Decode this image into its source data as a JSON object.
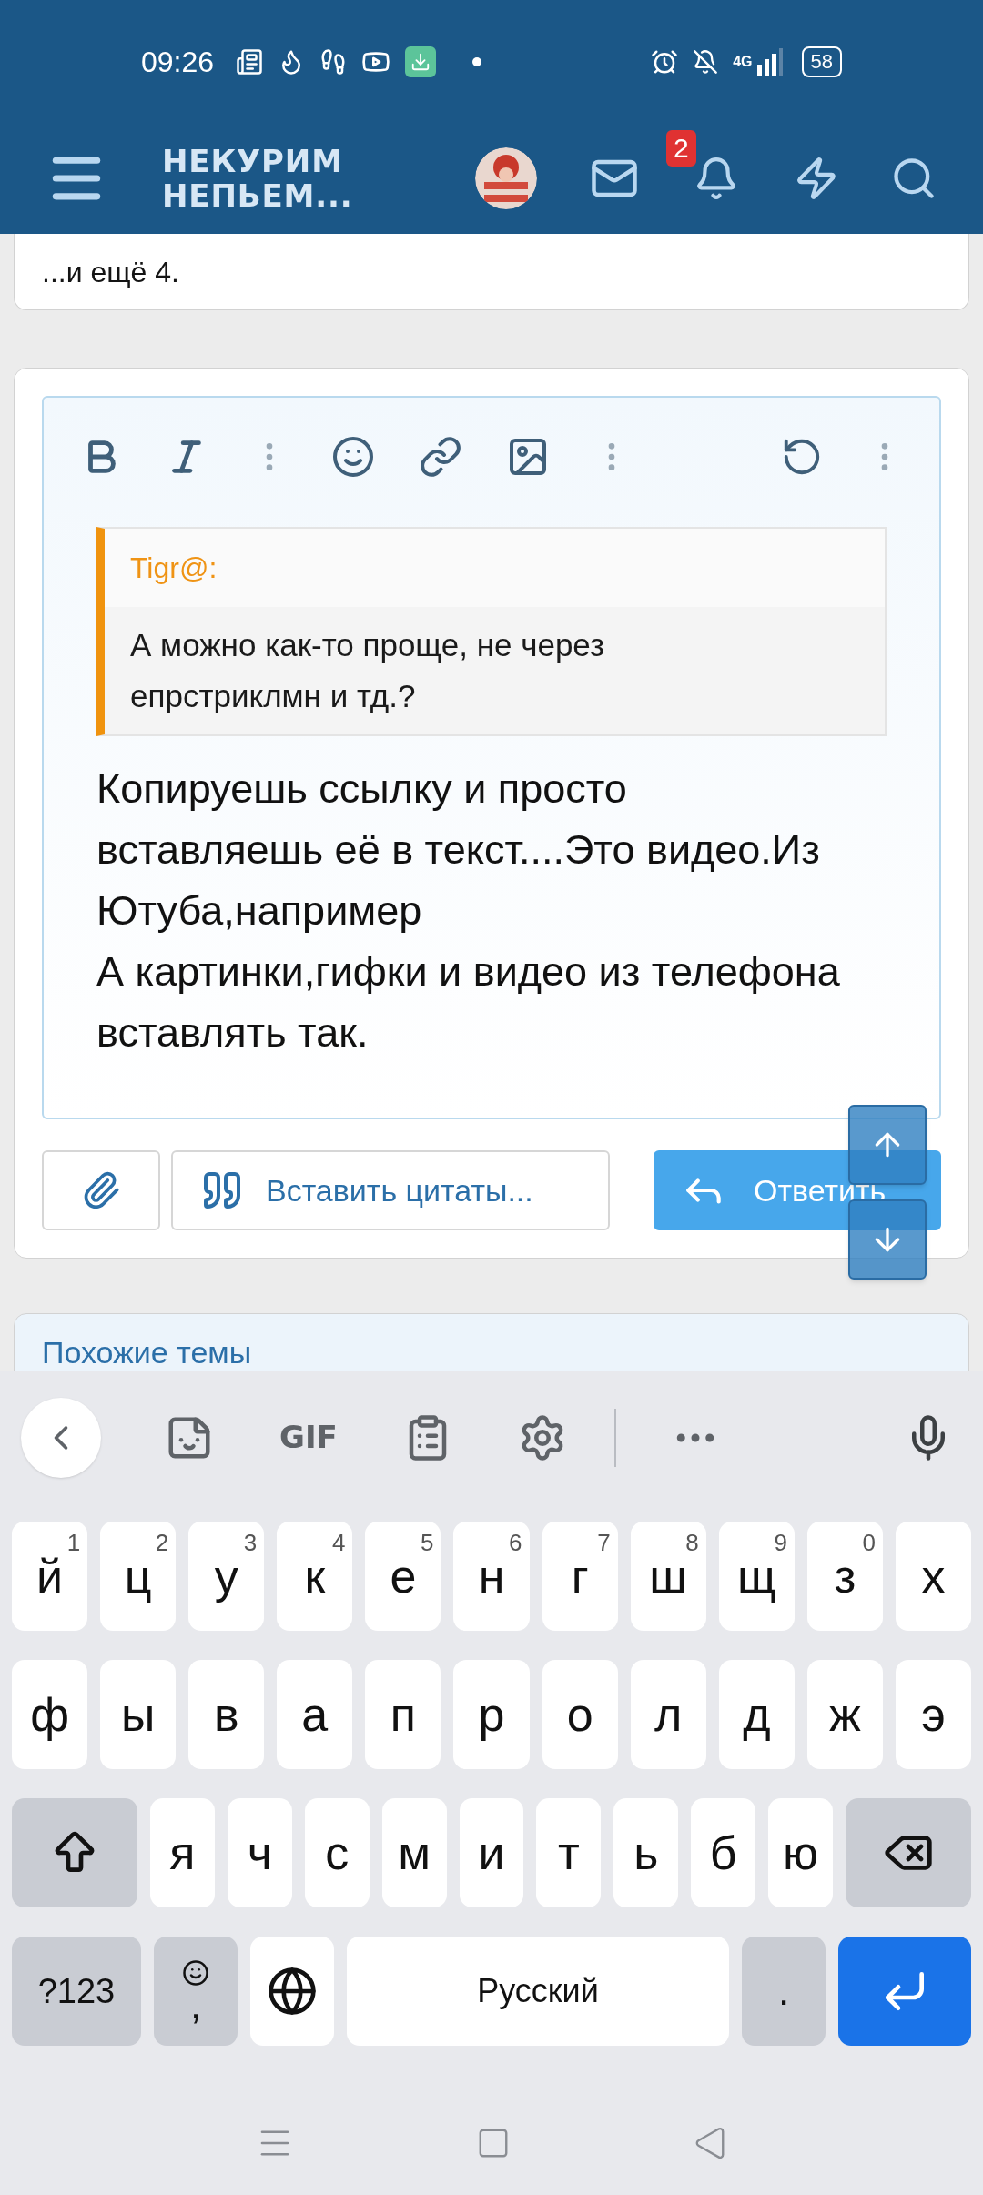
{
  "status_bar": {
    "time": "09:26",
    "network": "4G",
    "battery": "58"
  },
  "header": {
    "title_lines": [
      "НЕКУРИМ",
      "НЕПЬЕМ..."
    ],
    "notification_count": "2"
  },
  "previous_post": {
    "text": "...и ещё 4."
  },
  "editor": {
    "quote": {
      "author": "Tigr@:",
      "text": "А можно как-то проще, не через епрстриклмн и тд.?"
    },
    "paragraphs": [
      "Копируешь ссылку и просто вставляешь её в текст....Это видео.Из Ютуба,например",
      "А картинки,гифки и видео из телефона вставлять так."
    ]
  },
  "buttons": {
    "insert_quotes": "Вставить цитаты...",
    "reply": "Ответить"
  },
  "similar_threads": {
    "title": "Похожие темы"
  },
  "keyboard": {
    "gif": "GIF",
    "row1": [
      {
        "letter": "й",
        "hint": "1"
      },
      {
        "letter": "ц",
        "hint": "2"
      },
      {
        "letter": "у",
        "hint": "3"
      },
      {
        "letter": "к",
        "hint": "4"
      },
      {
        "letter": "е",
        "hint": "5"
      },
      {
        "letter": "н",
        "hint": "6"
      },
      {
        "letter": "г",
        "hint": "7"
      },
      {
        "letter": "ш",
        "hint": "8"
      },
      {
        "letter": "щ",
        "hint": "9"
      },
      {
        "letter": "з",
        "hint": "0"
      },
      {
        "letter": "х"
      }
    ],
    "row2": [
      "ф",
      "ы",
      "в",
      "а",
      "п",
      "р",
      "о",
      "л",
      "д",
      "ж",
      "э"
    ],
    "row3": [
      "я",
      "ч",
      "с",
      "м",
      "и",
      "т",
      "ь",
      "б",
      "ю"
    ],
    "symbols": "?123",
    "comma": ",",
    "space": "Русский",
    "period": "."
  }
}
